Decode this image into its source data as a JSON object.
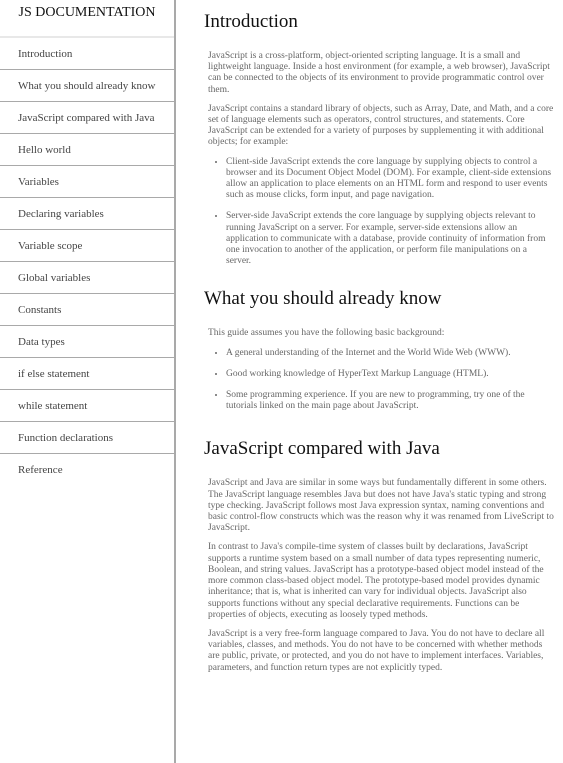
{
  "navbar": {
    "title": "JS DOCUMENTATION",
    "items": [
      {
        "label": "Introduction"
      },
      {
        "label": "What you should already know"
      },
      {
        "label": "JavaScript compared with Java"
      },
      {
        "label": "Hello world"
      },
      {
        "label": "Variables"
      },
      {
        "label": "Declaring variables"
      },
      {
        "label": "Variable scope"
      },
      {
        "label": "Global variables"
      },
      {
        "label": "Constants"
      },
      {
        "label": "Data types"
      },
      {
        "label": "if else statement"
      },
      {
        "label": "while statement"
      },
      {
        "label": "Function declarations"
      },
      {
        "label": "Reference"
      }
    ]
  },
  "sections": [
    {
      "title": "Introduction",
      "paragraphs": [
        "JavaScript is a cross-platform, object-oriented scripting language. It is a small and lightweight language. Inside a host environment (for example, a web browser), JavaScript can be connected to the objects of its environment to provide programmatic control over them.",
        "JavaScript contains a standard library of objects, such as Array, Date, and Math, and a core set of language elements such as operators, control structures, and statements. Core JavaScript can be extended for a variety of purposes by supplementing it with additional objects; for example:"
      ],
      "bullets": [
        "Client-side JavaScript extends the core language by supplying objects to control a browser and its Document Object Model (DOM). For example, client-side extensions allow an application to place elements on an HTML form and respond to user events such as mouse clicks, form input, and page navigation.",
        "Server-side JavaScript extends the core language by supplying objects relevant to running JavaScript on a server. For example, server-side extensions allow an application to communicate with a database, provide continuity of information from one invocation to another of the application, or perform file manipulations on a server."
      ]
    },
    {
      "title": "What you should already know",
      "paragraphs": [
        "This guide assumes you have the following basic background:"
      ],
      "bullets": [
        "A general understanding of the Internet and the World Wide Web (WWW).",
        "Good working knowledge of HyperText Markup Language (HTML).",
        "Some programming experience. If you are new to programming, try one of the tutorials linked on the main page about JavaScript."
      ]
    },
    {
      "title": "JavaScript compared with Java",
      "paragraphs": [
        "JavaScript and Java are similar in some ways but fundamentally different in some others. The JavaScript language resembles Java but does not have Java's static typing and strong type checking. JavaScript follows most Java expression syntax, naming conventions and basic control-flow constructs which was the reason why it was renamed from LiveScript to JavaScript.",
        "In contrast to Java's compile-time system of classes built by declarations, JavaScript supports a runtime system based on a small number of data types representing numeric, Boolean, and string values. JavaScript has a prototype-based object model instead of the more common class-based object model. The prototype-based model provides dynamic inheritance; that is, what is inherited can vary for individual objects. JavaScript also supports functions without any special declarative requirements. Functions can be properties of objects, executing as loosely typed methods.",
        "JavaScript is a very free-form language compared to Java. You do not have to declare all variables, classes, and methods. You do not have to be concerned with whether methods are public, private, or protected, and you do not have to implement interfaces. Variables, parameters, and function return types are not explicitly typed."
      ],
      "bullets": []
    }
  ]
}
